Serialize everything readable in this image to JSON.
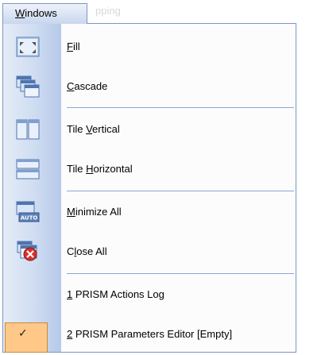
{
  "menu": {
    "title_prefix": "W",
    "title_rest": "indows",
    "ghost_text": "pping"
  },
  "items": [
    {
      "mnemonic": "F",
      "rest": "ill",
      "icon": "fill-icon"
    },
    {
      "mnemonic": "C",
      "rest": "ascade",
      "icon": "cascade-icon"
    },
    {
      "prefix": "Tile ",
      "mnemonic": "V",
      "rest": "ertical",
      "icon": "tile-vertical-icon"
    },
    {
      "prefix": "Tile ",
      "mnemonic": "H",
      "rest": "orizontal",
      "icon": "tile-horizontal-icon"
    },
    {
      "mnemonic": "M",
      "rest": "inimize All",
      "icon": "minimize-all-icon",
      "icon_text": "AUTO"
    },
    {
      "prefix": "C",
      "mnemonic": "l",
      "rest": "ose All",
      "icon": "close-all-icon"
    },
    {
      "mnemonic": "1",
      "rest": " PRISM Actions Log"
    },
    {
      "mnemonic": "2",
      "rest": " PRISM Parameters Editor [Empty]",
      "checked": true,
      "check_glyph": "✓"
    }
  ]
}
